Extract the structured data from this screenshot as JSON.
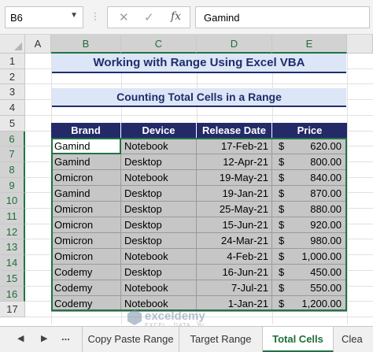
{
  "formula_bar": {
    "name_box": "B6",
    "cancel_icon": "✕",
    "enter_icon": "✓",
    "fx_label": "fx",
    "formula_value": "Gamind"
  },
  "columns": [
    "A",
    "B",
    "C",
    "D",
    "E"
  ],
  "rows": [
    "1",
    "2",
    "3",
    "4",
    "5",
    "6",
    "7",
    "8",
    "9",
    "10",
    "11",
    "12",
    "13",
    "14",
    "15",
    "16",
    "17"
  ],
  "title": "Working with Range Using Excel VBA",
  "subtitle": "Counting Total Cells in a Range",
  "table": {
    "headers": [
      "Brand",
      "Device",
      "Release Date",
      "Price"
    ],
    "currency_symbol": "$",
    "rows": [
      {
        "brand": "Gamind",
        "device": "Notebook",
        "date": "17-Feb-21",
        "price": "620.00"
      },
      {
        "brand": "Gamind",
        "device": "Desktop",
        "date": "12-Apr-21",
        "price": "800.00"
      },
      {
        "brand": "Omicron",
        "device": "Notebook",
        "date": "19-May-21",
        "price": "840.00"
      },
      {
        "brand": "Gamind",
        "device": "Desktop",
        "date": "19-Jan-21",
        "price": "870.00"
      },
      {
        "brand": "Omicron",
        "device": "Desktop",
        "date": "25-May-21",
        "price": "880.00"
      },
      {
        "brand": "Omicron",
        "device": "Desktop",
        "date": "15-Jun-21",
        "price": "920.00"
      },
      {
        "brand": "Omicron",
        "device": "Desktop",
        "date": "24-Mar-21",
        "price": "980.00"
      },
      {
        "brand": "Omicron",
        "device": "Notebook",
        "date": "4-Feb-21",
        "price": "1,000.00"
      },
      {
        "brand": "Codemy",
        "device": "Desktop",
        "date": "16-Jun-21",
        "price": "450.00"
      },
      {
        "brand": "Codemy",
        "device": "Notebook",
        "date": "7-Jul-21",
        "price": "550.00"
      },
      {
        "brand": "Codemy",
        "device": "Notebook",
        "date": "1-Jan-21",
        "price": "1,200.00"
      }
    ]
  },
  "sheet_tabs": {
    "ellipsis": "...",
    "tabs": [
      "Copy Paste Range",
      "Target Range",
      "Total Cells",
      "Clea"
    ],
    "active": "Total Cells"
  },
  "watermark": {
    "brand": "exceldemy",
    "tagline": "EXCEL · DATA · BI"
  },
  "colors": {
    "accent_green": "#217346",
    "header_navy": "#232a68",
    "title_fill": "#dde6f6"
  }
}
